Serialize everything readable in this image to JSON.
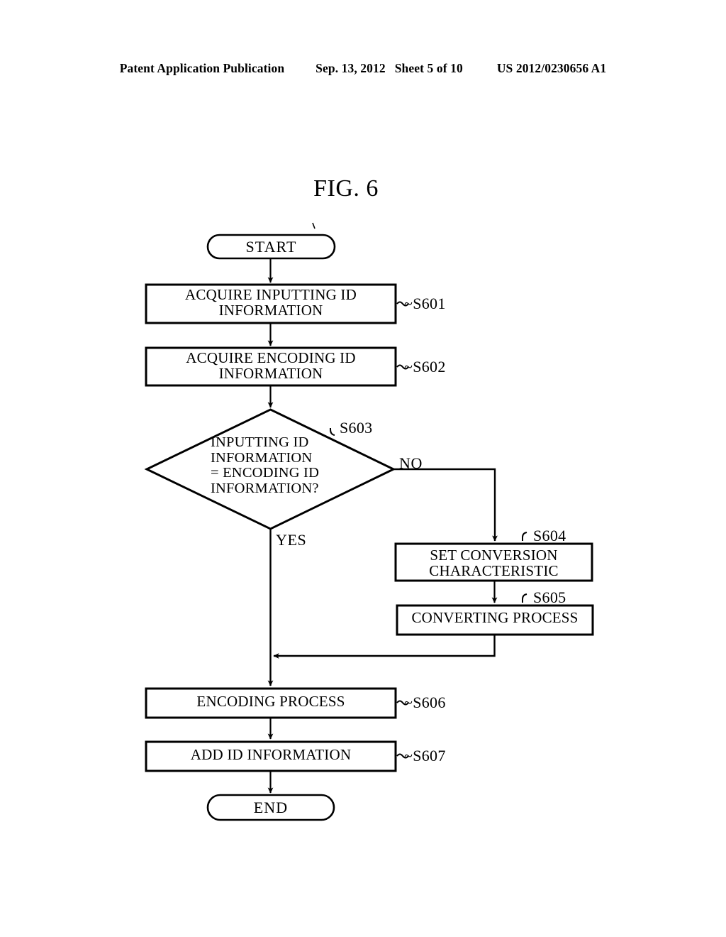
{
  "header": {
    "publication": "Patent Application Publication",
    "date": "Sep. 13, 2012",
    "sheet": "Sheet 5 of 10",
    "docnum": "US 2012/0230656 A1"
  },
  "figure": {
    "title": "FIG. 6"
  },
  "flowchart": {
    "start": {
      "label": "START"
    },
    "end": {
      "label": "END"
    },
    "steps": [
      {
        "id": "s601",
        "text": "ACQUIRE INPUTTING ID\nINFORMATION",
        "ref": "~S601"
      },
      {
        "id": "s602",
        "text": "ACQUIRE ENCODING ID\nINFORMATION",
        "ref": "~S602"
      },
      {
        "id": "s604",
        "text": "SET CONVERSION\nCHARACTERISTIC",
        "ref": "S604"
      },
      {
        "id": "s605",
        "text": "CONVERTING PROCESS",
        "ref": "S605"
      },
      {
        "id": "s606",
        "text": "ENCODING PROCESS",
        "ref": "~S606"
      },
      {
        "id": "s607",
        "text": "ADD ID INFORMATION",
        "ref": "~S607"
      }
    ],
    "decision": {
      "id": "s603",
      "text": "INPUTTING ID\nINFORMATION\n= ENCODING ID\nINFORMATION?",
      "ref": "S603",
      "yes_label": "YES",
      "no_label": "NO"
    }
  },
  "colors": {
    "ink": "#000000",
    "paper": "#ffffff"
  }
}
